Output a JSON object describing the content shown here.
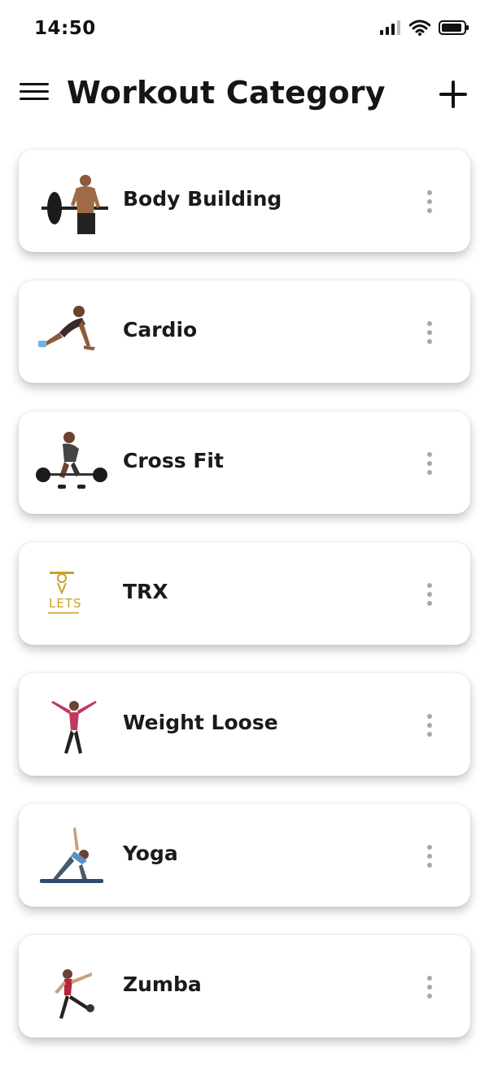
{
  "status_bar": {
    "time": "14:50"
  },
  "header": {
    "title": "Workout Category"
  },
  "categories": [
    {
      "label": "Body Building",
      "icon": "barbell-curl-icon"
    },
    {
      "label": "Cardio",
      "icon": "plank-icon"
    },
    {
      "label": "Cross Fit",
      "icon": "deadlift-icon"
    },
    {
      "label": "TRX",
      "icon": "lets-logo-icon",
      "logo_text": "LETS"
    },
    {
      "label": "Weight Loose",
      "icon": "jumping-jack-icon"
    },
    {
      "label": "Yoga",
      "icon": "triangle-pose-icon"
    },
    {
      "label": "Zumba",
      "icon": "dance-kick-icon"
    }
  ],
  "colors": {
    "accent_logo": "#c9a227",
    "dot_menu": "#a7a7a7"
  }
}
